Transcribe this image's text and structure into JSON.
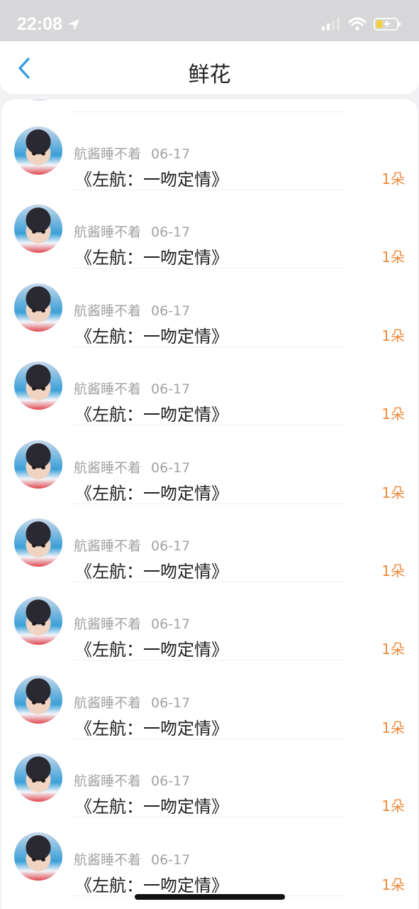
{
  "status": {
    "time": "22:08"
  },
  "header": {
    "title": "鲜花",
    "back_icon": "chevron-left-icon",
    "accent": "#2f9be0"
  },
  "rows": [
    {
      "user": "航酱睡不着",
      "date": "06-17",
      "gift": "《左航：一吻定情》",
      "amount": "1朵"
    },
    {
      "user": "航酱睡不着",
      "date": "06-17",
      "gift": "《左航：一吻定情》",
      "amount": "1朵"
    },
    {
      "user": "航酱睡不着",
      "date": "06-17",
      "gift": "《左航：一吻定情》",
      "amount": "1朵"
    },
    {
      "user": "航酱睡不着",
      "date": "06-17",
      "gift": "《左航：一吻定情》",
      "amount": "1朵"
    },
    {
      "user": "航酱睡不着",
      "date": "06-17",
      "gift": "《左航：一吻定情》",
      "amount": "1朵"
    },
    {
      "user": "航酱睡不着",
      "date": "06-17",
      "gift": "《左航：一吻定情》",
      "amount": "1朵"
    },
    {
      "user": "航酱睡不着",
      "date": "06-17",
      "gift": "《左航：一吻定情》",
      "amount": "1朵"
    },
    {
      "user": "航酱睡不着",
      "date": "06-17",
      "gift": "《左航：一吻定情》",
      "amount": "1朵"
    },
    {
      "user": "航酱睡不着",
      "date": "06-17",
      "gift": "《左航：一吻定情》",
      "amount": "1朵"
    },
    {
      "user": "航酱睡不着",
      "date": "06-17",
      "gift": "《左航：一吻定情》",
      "amount": "1朵"
    }
  ]
}
